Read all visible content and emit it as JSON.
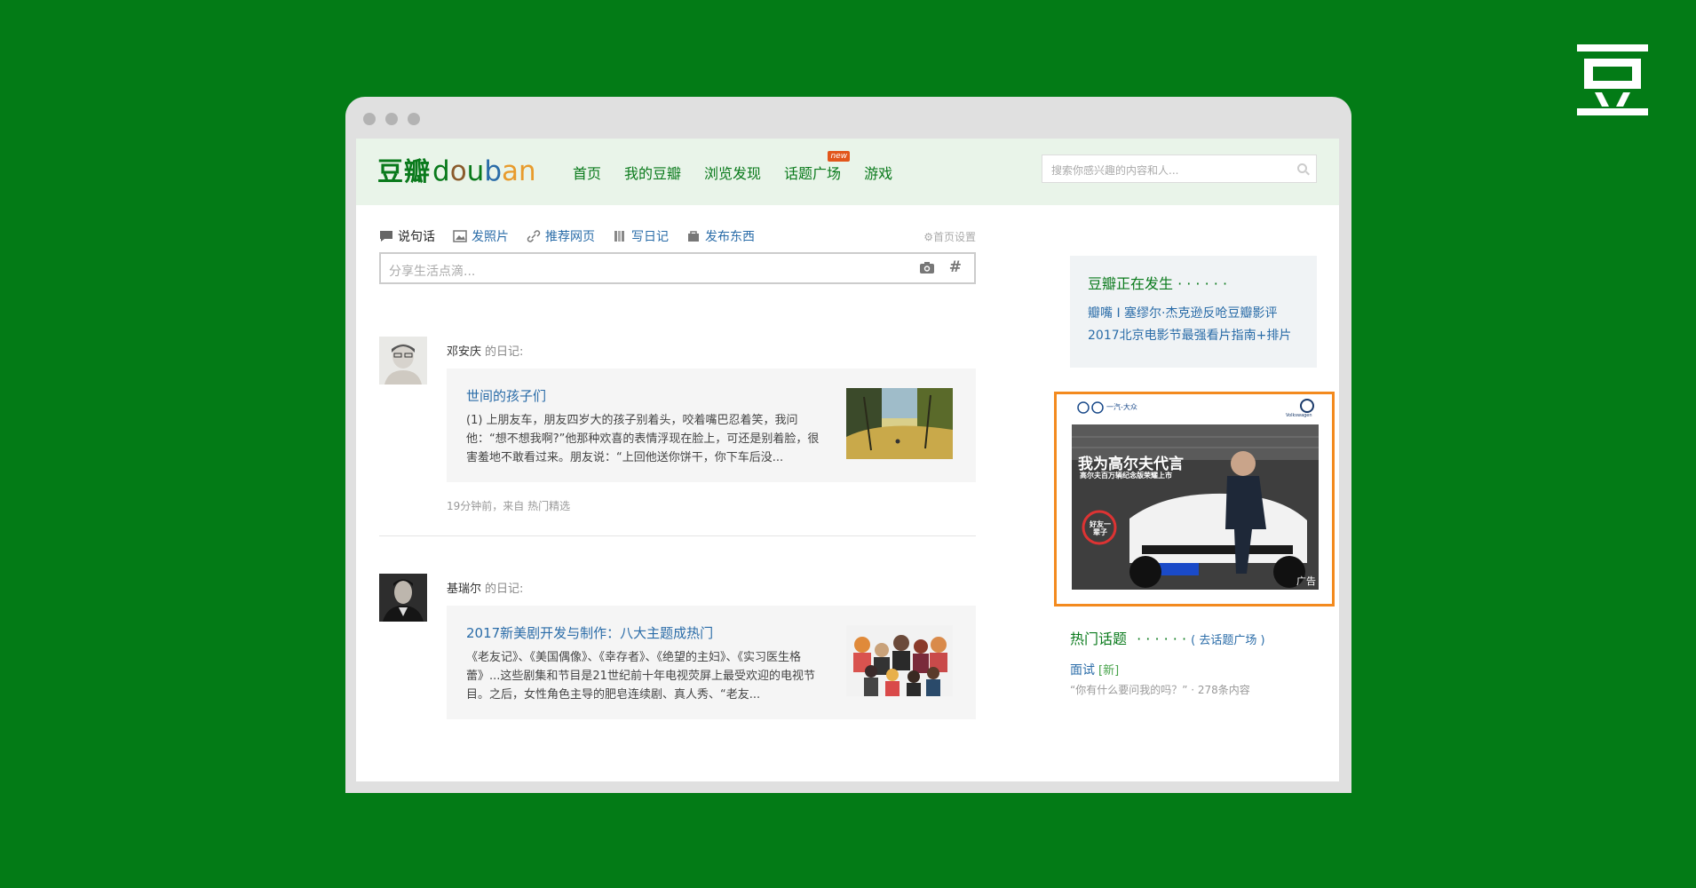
{
  "colors": {
    "background": "#037b16",
    "brand_green": "#0a7a1c",
    "link_blue": "#2a6ca8",
    "ad_border": "#f38a1e",
    "new_badge": "#e2561b"
  },
  "corner_logo": {
    "icon": "douban-glyph-icon"
  },
  "header": {
    "logo_cn": "豆瓣",
    "logo_en": [
      "d",
      "o",
      "u",
      "b",
      "a",
      "n"
    ],
    "nav": [
      {
        "label": "首页"
      },
      {
        "label": "我的豆瓣"
      },
      {
        "label": "浏览发现"
      },
      {
        "label": "话题广场",
        "badge": "new"
      },
      {
        "label": "游戏"
      }
    ],
    "search_placeholder": "搜索你感兴趣的内容和人..."
  },
  "composer": {
    "tabs": [
      {
        "label": "说句话",
        "icon": "speech-bubble-icon"
      },
      {
        "label": "发照片",
        "icon": "picture-icon"
      },
      {
        "label": "推荐网页",
        "icon": "link-icon"
      },
      {
        "label": "写日记",
        "icon": "book-icon"
      },
      {
        "label": "发布东西",
        "icon": "bag-icon"
      }
    ],
    "settings_label": "首页设置",
    "placeholder": "分享生活点滴...",
    "hash_symbol": "#"
  },
  "feed": [
    {
      "user": "邓安庆",
      "action": "的日记:",
      "title": "世间的孩子们",
      "excerpt": "(1) 上朋友车，朋友四岁大的孩子别着头，咬着嘴巴忍着笑，我问他：“想不想我啊?”他那种欢喜的表情浮现在脸上，可还是别着脸，很害羞地不敢看过来。朋友说：“上回他送你饼干，你下车后没...",
      "meta": "19分钟前，来自 热门精选"
    },
    {
      "user": "基瑞尔",
      "action": "的日记:",
      "title": "2017新美剧开发与制作：八大主题成热门",
      "excerpt": "《老友记》、《美国偶像》、《幸存者》、《绝望的主妇》、《实习医生格蕾》...这些剧集和节目是21世纪前十年电视荧屏上最受欢迎的电视节目。之后，女性角色主导的肥皂连续剧、真人秀、“老友..."
    }
  ],
  "sidebar": {
    "happening_title": "豆瓣正在发生 · · · · · ·",
    "happening_links": [
      "瓣嘴 I 塞缪尔·杰克逊反呛豆瓣影评",
      "2017北京电影节最强看片指南+排片"
    ],
    "ad": {
      "headline": "我为高尔夫代言",
      "subline": "高尔夫百万辆纪念版荣耀上市",
      "badge": "好友一辈子",
      "brand_left": "一汽-大众",
      "brand_right": "Volkswagen",
      "label": "广告"
    },
    "hot_title": "热门话题",
    "hot_dots": "· · · · · ·",
    "hot_more": "( 去话题广场 )",
    "hot_item": {
      "label": "面试",
      "tag": "[新]",
      "desc": "“你有什么要问我的吗？” · 278条内容"
    }
  }
}
